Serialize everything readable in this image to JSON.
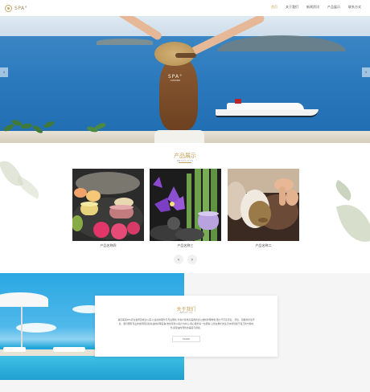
{
  "header": {
    "logo_text": "SPA°",
    "nav": [
      "首页",
      "关于我们",
      "新闻资讯",
      "产品展示",
      "联系方式"
    ],
    "active_index": 0
  },
  "hero": {
    "brand": "SPA°",
    "brand_sub": "GOODSPA",
    "prev": "‹",
    "next": "›"
  },
  "products": {
    "title": "产品展示",
    "subtitle": "PRODUCTS",
    "items": [
      {
        "label": "产品名称四"
      },
      {
        "label": "产品名称三"
      },
      {
        "label": "产品名称二"
      }
    ],
    "pager_prev": "‹",
    "pager_next": "›"
  },
  "about": {
    "title": "关于我们",
    "subtitle": "ABOUT US",
    "text": "遇见美丽SPA养生会所自成立以来,以良好的服务与专业理念,为客户提供高品质的身心放松护理体验,致力于打造专业、舒适、温馨的养生环境。我们拥有专业的技师团队和先进的护理设备,始终坚持以客户为中心,用心服务每一位顾客,让您在繁忙的生活中找到属于自己的宁静时光,感受由内而外的美丽与健康。",
    "more": "MORE"
  },
  "colors": {
    "accent": "#c8a25a",
    "sea": "#2b79bd",
    "pool": "#1ea6d8"
  }
}
